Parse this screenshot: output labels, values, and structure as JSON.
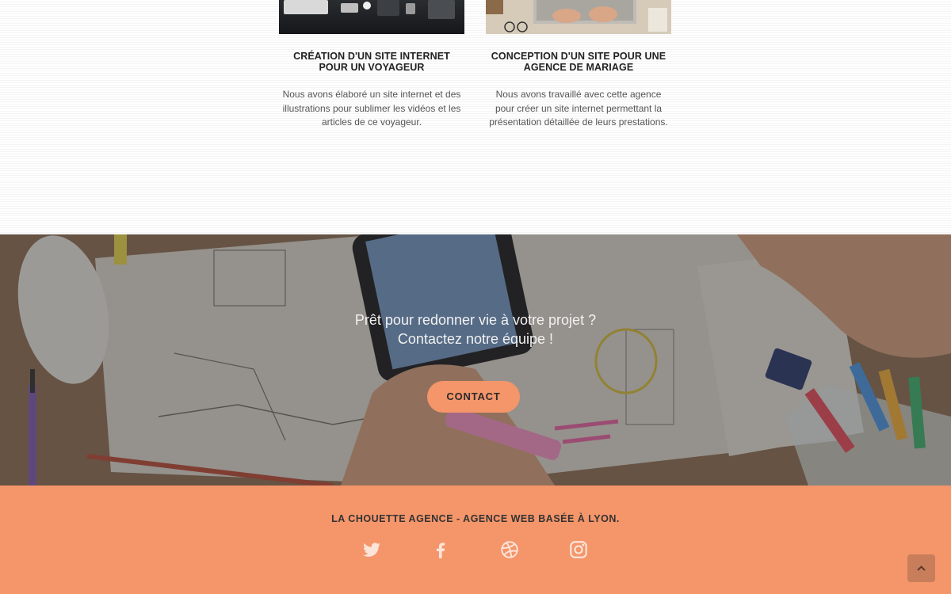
{
  "portfolio": {
    "cards": [
      {
        "title_line1": "CRÉATION D'UN SITE INTERNET",
        "title_line2": "POUR UN VOYAGEUR",
        "text_line1": "Nous avons élaboré un site internet et des",
        "text_line2": "illustrations pour sublimer les vidéos et les",
        "text_line3": "articles de ce voyageur."
      },
      {
        "title_line1": "CONCEPTION D'UN SITE POUR UNE",
        "title_line2": "AGENCE DE MARIAGE",
        "text_line1": "Nous avons travaillé avec cette agence",
        "text_line2": "pour créer un site internet permettant la",
        "text_line3": "présentation détaillée de leurs prestations."
      }
    ]
  },
  "cta": {
    "line1": "Prêt pour redonner vie à votre projet ?",
    "line2": "Contactez notre équipe !",
    "button_label": "CONTACT"
  },
  "footer": {
    "title": "LA CHOUETTE AGENCE - AGENCE WEB BASÉE À LYON.",
    "social_icons": [
      "twitter-icon",
      "facebook-icon",
      "dribbble-icon",
      "instagram-icon"
    ]
  },
  "scroll_top": {
    "icon": "chevron-up-icon"
  },
  "colors": {
    "accent": "#f4956a",
    "scroll_button": "#c97e5b",
    "heading": "#222222",
    "body_text": "#555555"
  }
}
